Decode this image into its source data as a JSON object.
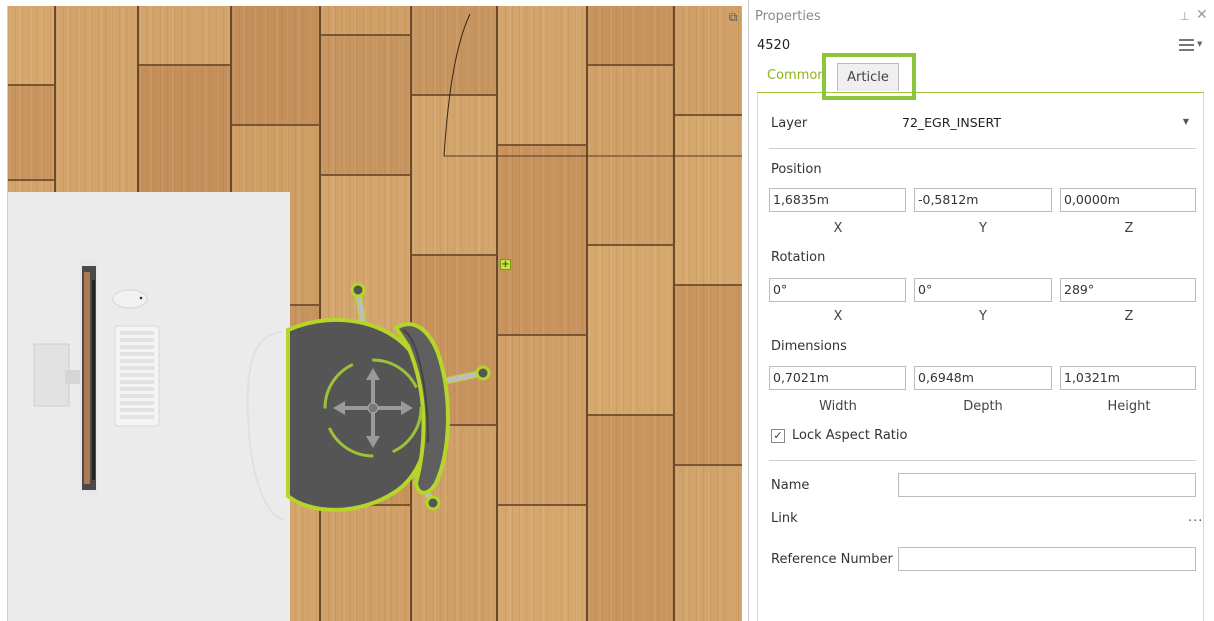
{
  "panel": {
    "title": "Properties",
    "object_id": "4520",
    "pin_glyph": "⊥",
    "close_glyph": "✕",
    "more_glyph": "...",
    "icons": {
      "pin": "pin-icon",
      "close": "close-icon",
      "menu": "hamburger-menu-icon",
      "dropdown": "chevron-down-icon",
      "checkbox": "checkmark-icon",
      "restore": "restore-window-icon",
      "snap": "plus-icon"
    }
  },
  "tabs": [
    {
      "label": "Common"
    },
    {
      "label": "Article"
    }
  ],
  "layer": {
    "label": "Layer",
    "value": "72_EGR_INSERT"
  },
  "position": {
    "label": "Position",
    "x": "1,6835m",
    "y": "-0,5812m",
    "z": "0,0000m",
    "x_label": "X",
    "y_label": "Y",
    "z_label": "Z"
  },
  "rotation": {
    "label": "Rotation",
    "x": "0°",
    "y": "0°",
    "z": "289°",
    "x_label": "X",
    "y_label": "Y",
    "z_label": "Z"
  },
  "dimensions": {
    "label": "Dimensions",
    "width": "0,7021m",
    "depth": "0,6948m",
    "height": "1,0321m",
    "width_label": "Width",
    "depth_label": "Depth",
    "height_label": "Height"
  },
  "lock_aspect": {
    "label": "Lock Aspect Ratio",
    "checked": true
  },
  "name": {
    "label": "Name",
    "value": ""
  },
  "link": {
    "label": "Link"
  },
  "reference": {
    "label": "Reference Number",
    "value": ""
  },
  "colors": {
    "accent_green": "#8cc43c",
    "tab_active_text": "#8fb21d",
    "selection_outline": "#b5d629",
    "floor_wood": "#c8945f"
  }
}
